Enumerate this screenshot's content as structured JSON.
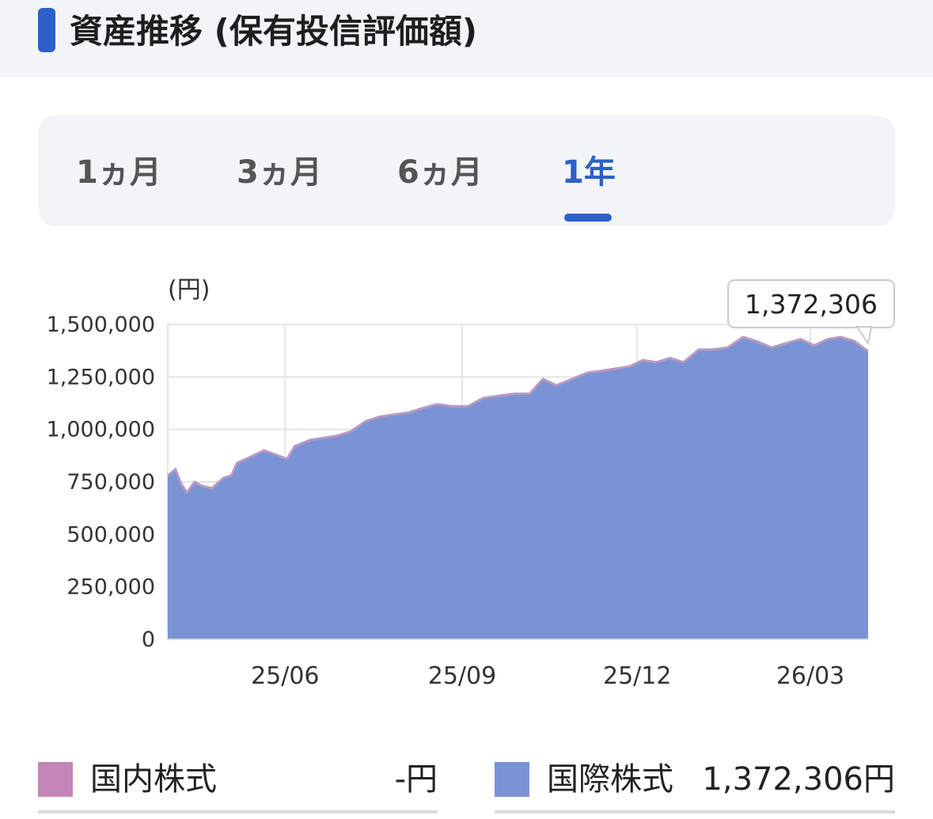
{
  "header": {
    "title": "資産推移 (保有投信評価額)"
  },
  "tabs": [
    {
      "label": "1ヵ月",
      "active": false
    },
    {
      "label": "3ヵ月",
      "active": false
    },
    {
      "label": "6ヵ月",
      "active": false
    },
    {
      "label": "1年",
      "active": true
    }
  ],
  "colors": {
    "accent": "#2c5fc8",
    "domestic": "#c485b8",
    "international": "#7a93d4"
  },
  "chart_data": {
    "type": "area",
    "ylabel": "(円)",
    "ylim": [
      0,
      1500000
    ],
    "yticks": [
      0,
      250000,
      500000,
      750000,
      1000000,
      1250000,
      1500000
    ],
    "ytick_labels": [
      "0",
      "250,000",
      "500,000",
      "750,000",
      "1,000,000",
      "1,250,000",
      "1,500,000"
    ],
    "xlim": [
      "2025-04-01",
      "2026-03-31"
    ],
    "xticks": [
      "2025-06-01",
      "2025-09-01",
      "2025-12-01",
      "2026-03-01"
    ],
    "xtick_labels": [
      "25/06",
      "25/09",
      "25/12",
      "26/03"
    ],
    "grid": true,
    "tooltip": "1,372,306",
    "series": [
      {
        "name": "国内株式",
        "color": "#c485b8",
        "values": [
          0
        ]
      },
      {
        "name": "国際株式",
        "color": "#7a93d4",
        "x": [
          "2025-04-01",
          "2025-04-05",
          "2025-04-08",
          "2025-04-11",
          "2025-04-15",
          "2025-04-19",
          "2025-04-24",
          "2025-04-30",
          "2025-05-04",
          "2025-05-07",
          "2025-05-14",
          "2025-05-21",
          "2025-05-27",
          "2025-06-02",
          "2025-06-06",
          "2025-06-14",
          "2025-06-21",
          "2025-06-28",
          "2025-07-05",
          "2025-07-13",
          "2025-07-20",
          "2025-07-27",
          "2025-08-04",
          "2025-08-11",
          "2025-08-19",
          "2025-08-27",
          "2025-09-04",
          "2025-09-12",
          "2025-09-20",
          "2025-09-28",
          "2025-10-06",
          "2025-10-13",
          "2025-10-20",
          "2025-10-28",
          "2025-11-05",
          "2025-11-13",
          "2025-11-20",
          "2025-11-27",
          "2025-12-04",
          "2025-12-11",
          "2025-12-18",
          "2025-12-25",
          "2026-01-02",
          "2026-01-09",
          "2026-01-17",
          "2026-01-25",
          "2026-02-01",
          "2026-02-09",
          "2026-02-16",
          "2026-02-24",
          "2026-03-03",
          "2026-03-10",
          "2026-03-17",
          "2026-03-24",
          "2026-03-31"
        ],
        "values": [
          780000,
          810000,
          740000,
          700000,
          750000,
          730000,
          720000,
          770000,
          780000,
          840000,
          870000,
          900000,
          880000,
          860000,
          920000,
          950000,
          960000,
          970000,
          990000,
          1040000,
          1060000,
          1070000,
          1080000,
          1100000,
          1120000,
          1110000,
          1110000,
          1150000,
          1160000,
          1170000,
          1170000,
          1240000,
          1210000,
          1240000,
          1270000,
          1280000,
          1290000,
          1300000,
          1330000,
          1320000,
          1340000,
          1320000,
          1380000,
          1380000,
          1390000,
          1440000,
          1420000,
          1390000,
          1410000,
          1430000,
          1400000,
          1430000,
          1440000,
          1420000,
          1372306
        ]
      }
    ]
  },
  "legend": [
    {
      "label": "国内株式",
      "value": "-円"
    },
    {
      "label": "国際株式",
      "value": "1,372,306円"
    }
  ]
}
